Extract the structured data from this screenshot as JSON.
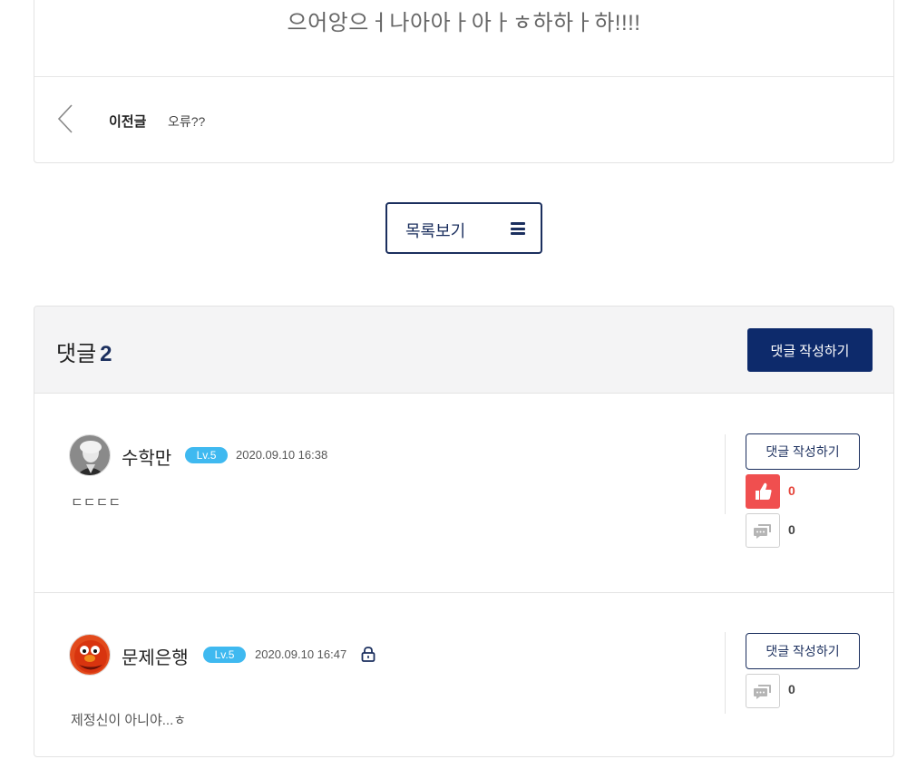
{
  "post": {
    "body_text": "으어앙으ㅓ나아아ㅏ아ㅏㅎ하하ㅏ하!!!!",
    "prev": {
      "label": "이전글",
      "title": "오류??"
    }
  },
  "list_button": {
    "label": "목록보기"
  },
  "comments": {
    "title": "댓글",
    "count": "2",
    "write_label": "댓글 작성하기",
    "items": [
      {
        "author": "수학만",
        "level": "Lv.5",
        "date": "2020.09.10 16:38",
        "text": "ㄷㄷㄷㄷ",
        "reply_label": "댓글 작성하기",
        "like_count": "0",
        "reply_count": "0",
        "locked": false
      },
      {
        "author": "문제은행",
        "level": "Lv.5",
        "date": "2020.09.10 16:47",
        "text": "제정신이 아니야...ㅎ",
        "reply_label": "댓글 작성하기",
        "reply_count": "0",
        "locked": true
      }
    ]
  },
  "colors": {
    "navy": "#1b2f5e",
    "button_navy": "#0d2a6b",
    "badge_blue": "#3fb9f0",
    "like_red": "#f04f4f"
  },
  "icons": {
    "prev": "chevron-left-icon",
    "list": "hamburger-icon",
    "like": "thumbs-up-icon",
    "reply": "speech-bubble-icon",
    "lock": "lock-icon"
  }
}
